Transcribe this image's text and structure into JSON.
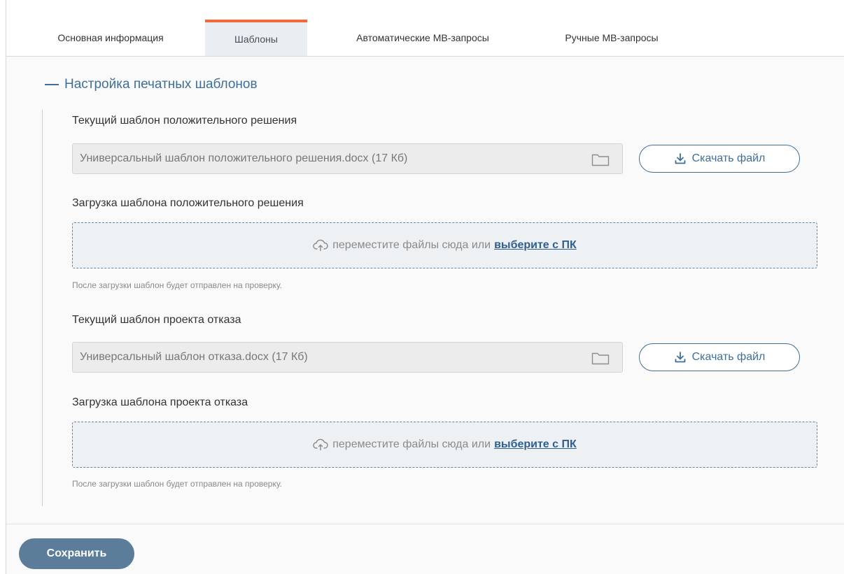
{
  "tabs": [
    {
      "label": "Основная информация",
      "active": false
    },
    {
      "label": "Шаблоны",
      "active": true
    },
    {
      "label": "Автоматические МВ-запросы",
      "active": false
    },
    {
      "label": "Ручные МВ-запросы",
      "active": false
    }
  ],
  "section": {
    "title": "Настройка печатных шаблонов",
    "collapse_icon": "minus-icon"
  },
  "positive": {
    "current_label": "Текущий шаблон положительного решения",
    "current_value": "Универсальный шаблон положительного решения.docx (17 Кб)",
    "download_label": "Скачать файл",
    "upload_label": "Загрузка шаблона положительного решения",
    "dropzone_text": "переместите файлы сюда или",
    "dropzone_link": "выберите с ПК",
    "hint": "После загрузки шаблон будет отправлен на проверку."
  },
  "refusal": {
    "current_label": "Текущий шаблон проекта отказа",
    "current_value": "Универсальный шаблон отказа.docx (17 Кб)",
    "download_label": "Скачать файл",
    "upload_label": "Загрузка шаблона проекта отказа",
    "dropzone_text": "переместите файлы сюда или",
    "dropzone_link": "выберите с ПК",
    "hint": "После загрузки шаблон будет отправлен на проверку."
  },
  "footer": {
    "save_label": "Сохранить"
  },
  "colors": {
    "accent": "#3f6f99",
    "active_tab_marker": "#f06a3b",
    "save_button": "#5b7d9a"
  },
  "icons": [
    "folder-icon",
    "download-icon",
    "cloud-upload-icon",
    "minus-icon"
  ]
}
